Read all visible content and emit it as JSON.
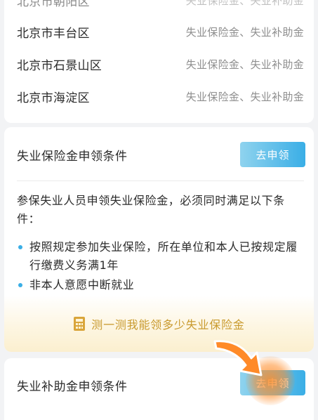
{
  "districts": [
    {
      "name": "北京市朝阳区",
      "subsidy": "失业保险金、失业补助金"
    },
    {
      "name": "北京市丰台区",
      "subsidy": "失业保险金、失业补助金"
    },
    {
      "name": "北京市石景山区",
      "subsidy": "失业保险金、失业补助金"
    },
    {
      "name": "北京市海淀区",
      "subsidy": "失业保险金、失业补助金"
    }
  ],
  "insurance": {
    "title": "失业保险金申领条件",
    "apply_label": "去申领",
    "intro": "参保失业人员申领失业保险金，必须同时满足以下条件：",
    "conditions": [
      "按照规定参加失业保险，所在单位和本人已按规定履行缴费义务满1年",
      "非本人意愿中断就业"
    ],
    "calc_link": "测一测我能领多少失业保险金",
    "calc_icon": "calculator-icon"
  },
  "subsidy": {
    "title": "失业补助金申领条件",
    "apply_label": "去申领"
  },
  "colors": {
    "accent": "#3aaee6",
    "gold": "#c99a2e",
    "pointer": "#ff8a28"
  }
}
